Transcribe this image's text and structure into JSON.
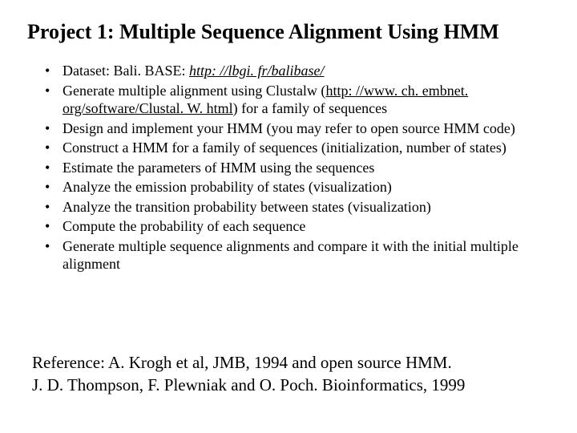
{
  "title": "Project 1: Multiple Sequence Alignment Using HMM",
  "bullets": {
    "b0_pre": "Dataset: Bali. BASE: ",
    "b0_link": "http: //lbgi. fr/balibase/",
    "b1_pre": "Generate multiple alignment using Clustalw (",
    "b1_link": "http: //www. ch. embnet. org/software/Clustal. W. html",
    "b1_post": ") for a family of sequences",
    "b2": "Design and implement your HMM (you may refer to open source HMM code)",
    "b3": "Construct a HMM for a family of sequences (initialization, number of states)",
    "b4": "Estimate the parameters of HMM using the sequences",
    "b5": "Analyze the emission probability of states (visualization)",
    "b6": "Analyze the transition probability between states (visualization)",
    "b7": "Compute the probability of each sequence",
    "b8": "Generate multiple sequence alignments and compare it with the initial multiple alignment"
  },
  "reference": {
    "line1": "Reference: A. Krogh et al, JMB, 1994 and open source HMM.",
    "line2": "J. D. Thompson, F. Plewniak and O. Poch. Bioinformatics, 1999"
  }
}
